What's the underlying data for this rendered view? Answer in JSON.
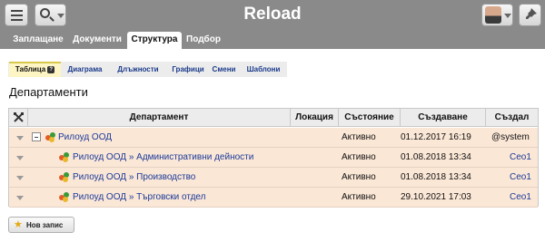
{
  "app": {
    "title": "Reload"
  },
  "nav": {
    "tabs": [
      "Заплащане",
      "Документи",
      "Структура",
      "Подбор"
    ],
    "active": "Структура"
  },
  "subnav": {
    "tabs": [
      "Таблица",
      "Диаграма",
      "Длъжности",
      "Графици",
      "Смени",
      "Шаблони"
    ],
    "active": "Таблица",
    "help_glyph": "?"
  },
  "page": {
    "title": "Департаменти"
  },
  "table": {
    "columns": [
      "Департамент",
      "Локация",
      "Състояние",
      "Създаване",
      "Създал"
    ],
    "rows": [
      {
        "department": "Рилоуд ООД",
        "location": "",
        "status": "Активно",
        "created": "01.12.2017 16:19",
        "creator": "@system"
      },
      {
        "department": "Рилоуд ООД » Административни дейности",
        "location": "",
        "status": "Активно",
        "created": "01.08.2018 13:34",
        "creator": "Ceo1"
      },
      {
        "department": "Рилоуд ООД » Производство",
        "location": "",
        "status": "Активно",
        "created": "01.08.2018 13:34",
        "creator": "Ceo1"
      },
      {
        "department": "Рилоуд ООД » Търговски отдел",
        "location": "",
        "status": "Активно",
        "created": "29.10.2021 17:03",
        "creator": "Ceo1"
      }
    ]
  },
  "actions": {
    "new_record": "Нов запис"
  },
  "icons": {
    "menu": "menu-icon",
    "search": "search-icon",
    "avatar": "user-avatar",
    "pin": "pin-icon",
    "tools": "tools-icon",
    "department": "department-icon",
    "new": "star-icon"
  },
  "colors": {
    "topbar": "#8a8a8a",
    "row_bg": "#fbe7d6",
    "link": "#1a3a9a",
    "active_subtab": "#fdf6c4"
  }
}
